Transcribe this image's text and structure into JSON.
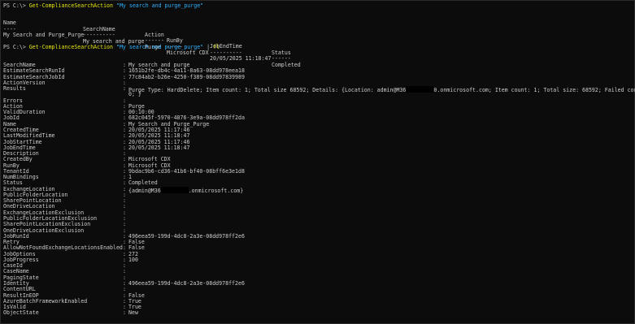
{
  "terminal": {
    "command1": {
      "prompt": "PS C:\\> ",
      "cmdlet": "Get-ComplianceSearchAction",
      "argument": "\"My search and purge_purge\""
    },
    "table": {
      "headers": [
        "Name",
        "SearchName",
        "Action",
        "RunBy",
        "JobEndTime",
        "Status"
      ],
      "underlines": [
        "----",
        "----------",
        "------",
        "-----",
        "----------",
        "------"
      ],
      "row": [
        "My Search and Purge_Purge",
        "My search and purge",
        "Purge",
        "Microsoft CDX",
        "20/05/2025 11:18:47",
        "Completed"
      ]
    },
    "command2": {
      "prompt": "PS C:\\> ",
      "cmdlet": "Get-ComplianceSearchAction",
      "argument": "\"My search and purge_purge\"",
      "pipe": " | ",
      "formatter": "fl"
    },
    "properties": [
      {
        "name": "SearchName",
        "value": "My search and purge"
      },
      {
        "name": "EstimateSearchRunId",
        "value": "1651b2fe-db4c-4a11-8a63-08dd978eea18"
      },
      {
        "name": "EstimateSearchJobId",
        "value": "77c84ab2-b26e-4250-f389-08dd97839989"
      },
      {
        "name": "ActionVersion",
        "value": ""
      },
      {
        "name": "Results",
        "value": "Purge Type: HardDelete; Item count: 1; Total size 68592; Details: {Location: admin@M36",
        "redacted_after": true,
        "value_tail": "0.onmicrosoft.com; Item count: 1; Total size: 68592; Failed count:"
      },
      {
        "name": "",
        "value": "0; }"
      },
      {
        "name": "Errors",
        "value": ""
      },
      {
        "name": "Action",
        "value": "Purge"
      },
      {
        "name": "ValidDuration",
        "value": "00:10:00"
      },
      {
        "name": "JobId",
        "value": "682c045f-5970-4876-3e9a-08dd978ff2da"
      },
      {
        "name": "Name",
        "value": "My Search and Purge_Purge"
      },
      {
        "name": "CreatedTime",
        "value": "20/05/2025 11:17:46"
      },
      {
        "name": "LastModifiedTime",
        "value": "20/05/2025 11:18:47"
      },
      {
        "name": "JobStartTime",
        "value": "20/05/2025 11:17:46"
      },
      {
        "name": "JobEndTime",
        "value": "20/05/2025 11:18:47"
      },
      {
        "name": "Description",
        "value": ""
      },
      {
        "name": "CreatedBy",
        "value": "Microsoft CDX"
      },
      {
        "name": "RunBy",
        "value": "Microsoft CDX"
      },
      {
        "name": "TenantId",
        "value": "9bdac9b6-cd36-41b6-bf40-08bff6e3e1d8"
      },
      {
        "name": "NumBindings",
        "value": "1"
      },
      {
        "name": "Status",
        "value": "Completed"
      },
      {
        "name": "ExchangeLocation",
        "value": "{admin@M36",
        "redacted_after": true,
        "value_tail": ".onmicrosoft.com}"
      },
      {
        "name": "PublicFolderLocation",
        "value": ""
      },
      {
        "name": "SharePointLocation",
        "value": ""
      },
      {
        "name": "OneDriveLocation",
        "value": ""
      },
      {
        "name": "ExchangeLocationExclusion",
        "value": ""
      },
      {
        "name": "PublicFolderLocationExclusion",
        "value": ""
      },
      {
        "name": "SharePointLocationExclusion",
        "value": ""
      },
      {
        "name": "OneDriveLocationExclusion",
        "value": ""
      },
      {
        "name": "JobRunId",
        "value": "496eea59-199d-4dc8-2a3e-08dd978ff2e6"
      },
      {
        "name": "Retry",
        "value": "False"
      },
      {
        "name": "AllowNotFoundExchangeLocationsEnabled",
        "value": "False"
      },
      {
        "name": "JobOptions",
        "value": "272"
      },
      {
        "name": "JobProgress",
        "value": "100"
      },
      {
        "name": "CaseId",
        "value": ""
      },
      {
        "name": "CaseName",
        "value": ""
      },
      {
        "name": "PagingState",
        "value": ""
      },
      {
        "name": "Identity",
        "value": "496eea59-199d-4dc8-2a3e-08dd978ff2e6"
      },
      {
        "name": "ContentURL",
        "value": ""
      },
      {
        "name": "ResultInEOP",
        "value": "False"
      },
      {
        "name": "AzureBatchFrameworkEnabled",
        "value": "True"
      },
      {
        "name": "IsValid",
        "value": "True"
      },
      {
        "name": "ObjectState",
        "value": "New"
      }
    ],
    "separator": ":"
  },
  "colors": {
    "background": "#0c0c0c",
    "text": "#cccccc",
    "cmdlet": "#e5e510",
    "string": "#2fb2ff"
  }
}
